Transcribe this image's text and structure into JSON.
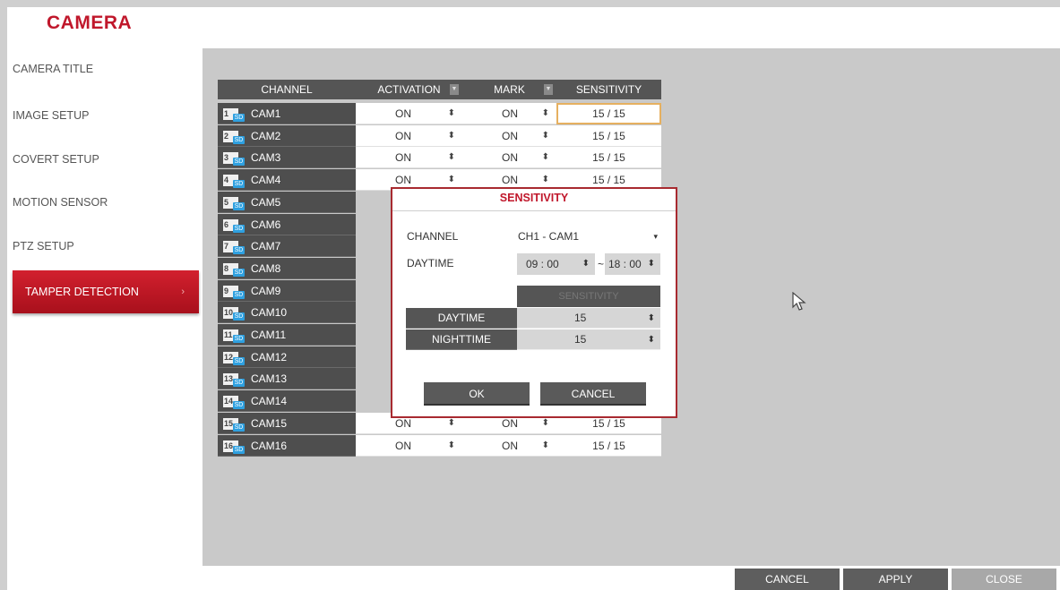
{
  "app": {
    "title": "CAMERA"
  },
  "sidebar": {
    "items": [
      {
        "label": "CAMERA TITLE"
      },
      {
        "label": "IMAGE SETUP"
      },
      {
        "label": "COVERT SETUP"
      },
      {
        "label": "MOTION SENSOR"
      },
      {
        "label": "PTZ SETUP"
      },
      {
        "label": "TAMPER DETECTION",
        "active": true
      }
    ]
  },
  "table": {
    "headers": {
      "channel": "CHANNEL",
      "activation": "ACTIVATION",
      "mark": "MARK",
      "sensitivity": "SENSITIVITY"
    },
    "sd_badge": "SD",
    "rows": [
      {
        "num": "1",
        "name": "CAM1",
        "activation": "ON",
        "mark": "ON",
        "sensitivity": "15 / 15"
      },
      {
        "num": "2",
        "name": "CAM2",
        "activation": "ON",
        "mark": "ON",
        "sensitivity": "15 / 15"
      },
      {
        "num": "3",
        "name": "CAM3",
        "activation": "ON",
        "mark": "ON",
        "sensitivity": "15 / 15"
      },
      {
        "num": "4",
        "name": "CAM4",
        "activation": "ON",
        "mark": "ON",
        "sensitivity": "15 / 15"
      },
      {
        "num": "5",
        "name": "CAM5"
      },
      {
        "num": "6",
        "name": "CAM6"
      },
      {
        "num": "7",
        "name": "CAM7"
      },
      {
        "num": "8",
        "name": "CAM8"
      },
      {
        "num": "9",
        "name": "CAM9"
      },
      {
        "num": "10",
        "name": "CAM10"
      },
      {
        "num": "11",
        "name": "CAM11"
      },
      {
        "num": "12",
        "name": "CAM12"
      },
      {
        "num": "13",
        "name": "CAM13"
      },
      {
        "num": "14",
        "name": "CAM14"
      },
      {
        "num": "15",
        "name": "CAM15",
        "activation": "ON",
        "mark": "ON",
        "sensitivity": "15 / 15"
      },
      {
        "num": "16",
        "name": "CAM16",
        "activation": "ON",
        "mark": "ON",
        "sensitivity": "15 / 15"
      }
    ]
  },
  "dialog": {
    "title": "SENSITIVITY",
    "channel_label": "CHANNEL",
    "channel_value": "CH1 - CAM1",
    "daytime_label": "DAYTIME",
    "time_start": "09 : 00",
    "time_sep": "~",
    "time_end": "18 : 00",
    "sens_header": "SENSITIVITY",
    "rows": [
      {
        "label": "DAYTIME",
        "value": "15"
      },
      {
        "label": "NIGHTTIME",
        "value": "15"
      }
    ],
    "ok_label": "OK",
    "cancel_label": "CANCEL"
  },
  "footer": {
    "cancel_label": "CANCEL",
    "apply_label": "APPLY",
    "close_label": "CLOSE"
  },
  "colors": {
    "accent": "#c0172b",
    "header": "#555555",
    "panel": "#c9c9c9"
  },
  "icons": {
    "spinner": "updown-arrows-icon",
    "dropdown": "chevron-down-icon",
    "cursor": "mouse-pointer-icon"
  }
}
